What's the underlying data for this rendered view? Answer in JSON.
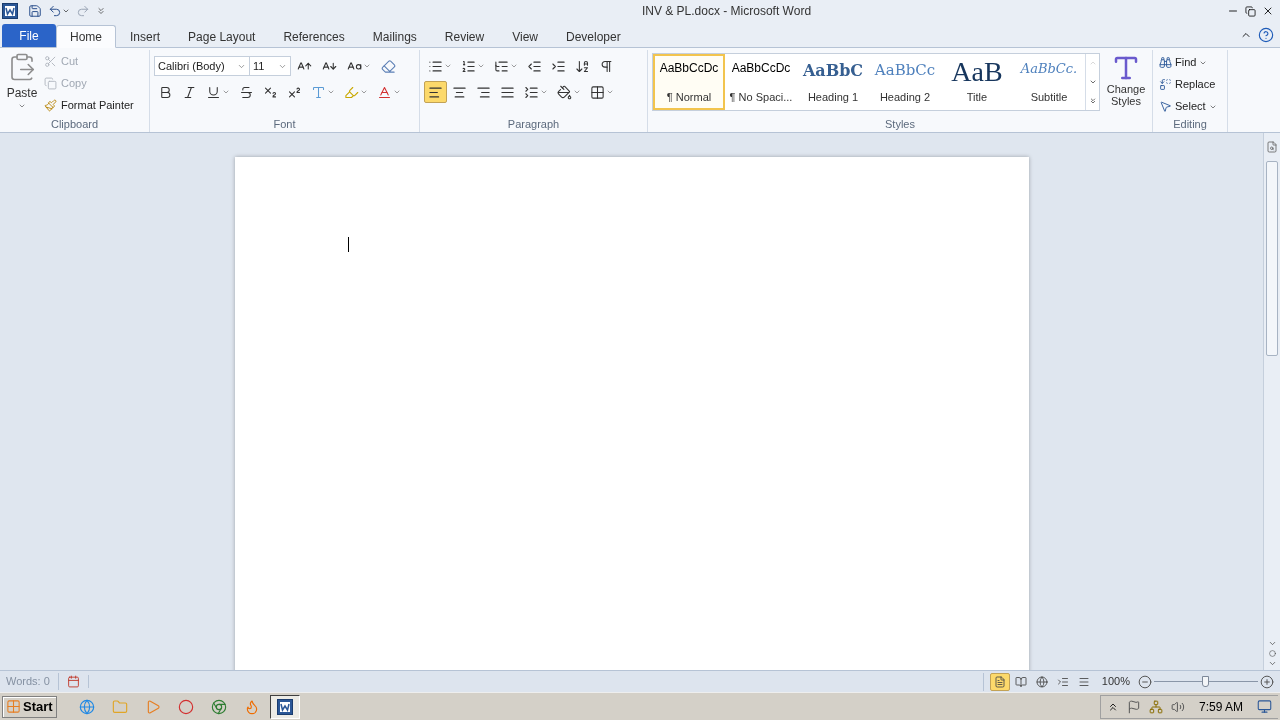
{
  "window": {
    "title": "INV & PL.docx - Microsoft Word"
  },
  "tabs": [
    {
      "label": "File",
      "kind": "file",
      "selected": false
    },
    {
      "label": "Home",
      "kind": "tab",
      "selected": true
    },
    {
      "label": "Insert",
      "kind": "tab",
      "selected": false
    },
    {
      "label": "Page Layout",
      "kind": "tab",
      "selected": false
    },
    {
      "label": "References",
      "kind": "tab",
      "selected": false
    },
    {
      "label": "Mailings",
      "kind": "tab",
      "selected": false
    },
    {
      "label": "Review",
      "kind": "tab",
      "selected": false
    },
    {
      "label": "View",
      "kind": "tab",
      "selected": false
    },
    {
      "label": "Developer",
      "kind": "tab",
      "selected": false
    }
  ],
  "clipboard": {
    "label": "Clipboard",
    "paste": "Paste",
    "items": [
      {
        "label": "Cut",
        "kind": "cut",
        "disabled": true
      },
      {
        "label": "Copy",
        "kind": "copy",
        "disabled": true
      },
      {
        "label": "Format Painter",
        "kind": "painter",
        "disabled": false
      }
    ]
  },
  "font": {
    "label": "Font",
    "font_name": "Calibri (Body)",
    "font_size": "11"
  },
  "paragraph": {
    "label": "Paragraph",
    "alignments": [
      {
        "kind": "left",
        "selected": true
      },
      {
        "kind": "center",
        "selected": false
      },
      {
        "kind": "right",
        "selected": false
      },
      {
        "kind": "justify",
        "selected": false
      }
    ]
  },
  "styles": {
    "label": "Styles",
    "items": [
      {
        "preview": "AaBbCcDc",
        "name": "¶ Normal",
        "kind": "normal",
        "selected": true
      },
      {
        "preview": "AaBbCcDc",
        "name": "¶ No Spaci...",
        "kind": "normal",
        "selected": false
      },
      {
        "preview": "AaBbC",
        "name": "Heading 1",
        "kind": "heading1",
        "selected": false
      },
      {
        "preview": "AaBbCc",
        "name": "Heading 2",
        "kind": "heading2",
        "selected": false
      },
      {
        "preview": "AaB",
        "name": "Title",
        "kind": "title",
        "selected": false
      },
      {
        "preview": "AaBbCc.",
        "name": "Subtitle",
        "kind": "subtitle",
        "selected": false
      }
    ],
    "change_styles": "Change Styles"
  },
  "editing": {
    "label": "Editing",
    "items": [
      {
        "label": "Find",
        "kind": "find"
      },
      {
        "label": "Replace",
        "kind": "replace"
      },
      {
        "label": "Select",
        "kind": "select"
      }
    ]
  },
  "status_bar": {
    "words": "Words: 0",
    "zoom": "100%",
    "level": 0.5,
    "views": [
      {
        "kind": "print",
        "selected": true
      },
      {
        "kind": "reading",
        "selected": false
      },
      {
        "kind": "web",
        "selected": false
      },
      {
        "kind": "outline",
        "selected": false
      },
      {
        "kind": "draft",
        "selected": false
      }
    ]
  },
  "taskbar": {
    "start": "Start",
    "clock": "7:59 AM",
    "apps": [
      {
        "kind": "ie",
        "selected": false
      },
      {
        "kind": "folder",
        "selected": false
      },
      {
        "kind": "media",
        "selected": false
      },
      {
        "kind": "opera",
        "selected": false
      },
      {
        "kind": "chrome",
        "selected": false
      },
      {
        "kind": "firefox",
        "selected": false
      },
      {
        "kind": "word",
        "selected": true
      }
    ]
  }
}
